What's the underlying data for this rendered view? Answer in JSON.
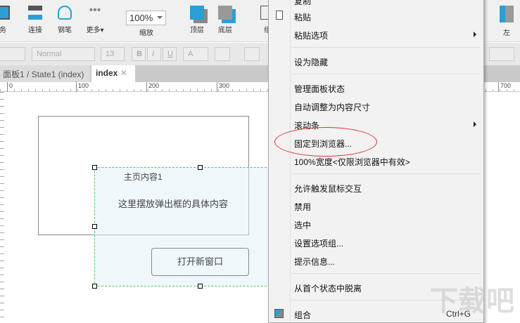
{
  "toolbar": {
    "items": [
      {
        "label": "务"
      },
      {
        "label": "连接"
      },
      {
        "label": "钢笔"
      },
      {
        "label": "更多▾"
      },
      {
        "label": "缩放"
      },
      {
        "label": "顶层"
      },
      {
        "label": "底层"
      },
      {
        "label": "组"
      },
      {
        "label": "左"
      }
    ],
    "zoom_value": "100%"
  },
  "format": {
    "style": "Normal",
    "size": "13",
    "bold": "B",
    "italic": "I",
    "underline": "U",
    "fontcolor": "A"
  },
  "tabs": [
    {
      "label": "面板1 / State1 (index)"
    },
    {
      "label": "index"
    }
  ],
  "ruler": [
    "0",
    "100",
    "200",
    "300",
    "700"
  ],
  "canvas": {
    "title": "主页内容1",
    "body": "这里摆放弹出框的具体内容",
    "button": "打开新窗口"
  },
  "menu": {
    "items": [
      {
        "label": "复制"
      },
      {
        "label": "粘贴"
      },
      {
        "label": "粘贴选项"
      },
      {
        "label": "设为隐藏"
      },
      {
        "label": "管理面板状态"
      },
      {
        "label": "自动调整为内容尺寸"
      },
      {
        "label": "滚动条"
      },
      {
        "label": "固定到浏览器..."
      },
      {
        "label": "100%宽度<仅限浏览器中有效>"
      },
      {
        "label": "允许触发鼠标交互"
      },
      {
        "label": "禁用"
      },
      {
        "label": "选中"
      },
      {
        "label": "设置选项组..."
      },
      {
        "label": "提示信息..."
      },
      {
        "label": "从首个状态中脱离"
      },
      {
        "label": "组合",
        "shortcut": "Ctrl+G"
      }
    ]
  },
  "watermark": "下载吧"
}
